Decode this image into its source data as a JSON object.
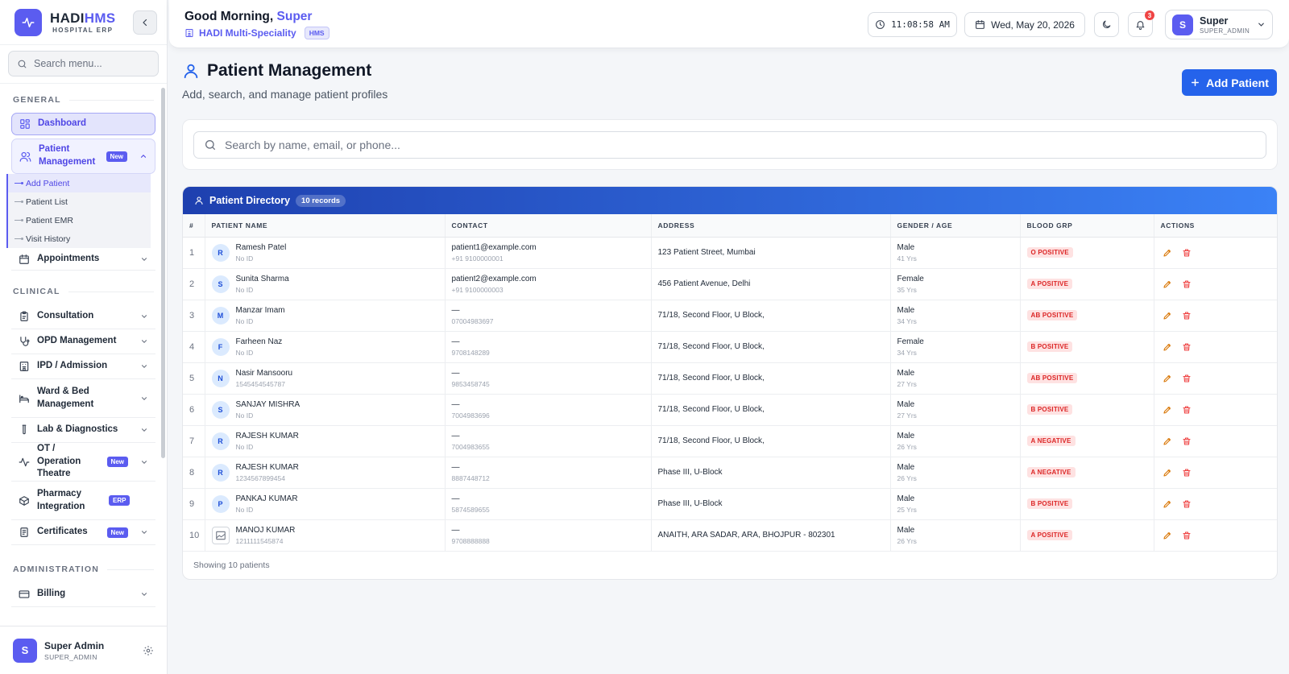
{
  "brand": {
    "name_part1": "HADI",
    "name_part2": "HMS",
    "subtitle": "HOSPITAL ERP"
  },
  "sidebar": {
    "search_placeholder": "Search menu...",
    "sections": {
      "general": "GENERAL",
      "clinical": "CLINICAL",
      "administration": "ADMINISTRATION"
    },
    "items": {
      "dashboard": "Dashboard",
      "patient_management": "Patient Management",
      "appointments": "Appointments",
      "consultation": "Consultation",
      "opd": "OPD Management",
      "ipd": "IPD / Admission",
      "ward": "Ward & Bed Management",
      "lab": "Lab & Diagnostics",
      "ot": "OT / Operation Theatre",
      "pharmacy": "Pharmacy Integration",
      "certificates": "Certificates",
      "billing": "Billing"
    },
    "submenu": [
      "Add Patient",
      "Patient List",
      "Patient EMR",
      "Visit History"
    ],
    "badges": {
      "new": "New",
      "erp": "ERP"
    },
    "footer": {
      "avatar": "S",
      "name": "Super Admin",
      "role": "SUPER_ADMIN"
    }
  },
  "header": {
    "greeting": "Good Morning,",
    "user_first": "Super",
    "hospital": "HADI Multi-Speciality",
    "hospital_tag": "HMS",
    "time": "11:08:58 AM",
    "date": "Wed, May 20, 2026",
    "notification_count": "3",
    "user": {
      "avatar": "S",
      "name": "Super",
      "role": "SUPER_ADMIN"
    }
  },
  "page": {
    "title": "Patient Management",
    "subtitle": "Add, search, and manage patient profiles",
    "add_button": "Add Patient",
    "search_placeholder": "Search by name, email, or phone..."
  },
  "directory": {
    "title": "Patient Directory",
    "records": "10 records",
    "columns": [
      "#",
      "PATIENT NAME",
      "CONTACT",
      "ADDRESS",
      "GENDER / AGE",
      "BLOOD GRP",
      "ACTIONS"
    ],
    "rows": [
      {
        "n": "1",
        "initial": "R",
        "name": "Ramesh Patel",
        "pid": "No ID",
        "email": "patient1@example.com",
        "phone": "+91 9100000001",
        "address": "123 Patient Street, Mumbai",
        "gender": "Male",
        "age": "41 Yrs",
        "blood": "O POSITIVE"
      },
      {
        "n": "2",
        "initial": "S",
        "name": "Sunita Sharma",
        "pid": "No ID",
        "email": "patient2@example.com",
        "phone": "+91 9100000003",
        "address": "456 Patient Avenue, Delhi",
        "gender": "Female",
        "age": "35 Yrs",
        "blood": "A POSITIVE"
      },
      {
        "n": "3",
        "initial": "M",
        "name": "Manzar Imam",
        "pid": "No ID",
        "email": "—",
        "phone": "07004983697",
        "address": "71/18, Second Floor, U Block,",
        "gender": "Male",
        "age": "34 Yrs",
        "blood": "AB POSITIVE"
      },
      {
        "n": "4",
        "initial": "F",
        "name": "Farheen Naz",
        "pid": "No ID",
        "email": "—",
        "phone": "9708148289",
        "address": "71/18, Second Floor, U Block,",
        "gender": "Female",
        "age": "34 Yrs",
        "blood": "B POSITIVE"
      },
      {
        "n": "5",
        "initial": "N",
        "name": "Nasir Mansooru",
        "pid": "1545454545787",
        "email": "—",
        "phone": "9853458745",
        "address": "71/18, Second Floor, U Block,",
        "gender": "Male",
        "age": "27 Yrs",
        "blood": "AB POSITIVE"
      },
      {
        "n": "6",
        "initial": "S",
        "name": "SANJAY MISHRA",
        "pid": "No ID",
        "email": "—",
        "phone": "7004983696",
        "address": "71/18, Second Floor, U Block,",
        "gender": "Male",
        "age": "27 Yrs",
        "blood": "B POSITIVE"
      },
      {
        "n": "7",
        "initial": "R",
        "name": "RAJESH KUMAR",
        "pid": "No ID",
        "email": "—",
        "phone": "7004983655",
        "address": "71/18, Second Floor, U Block,",
        "gender": "Male",
        "age": "26 Yrs",
        "blood": "A NEGATIVE"
      },
      {
        "n": "8",
        "initial": "R",
        "name": "RAJESH KUMAR",
        "pid": "1234567899454",
        "email": "—",
        "phone": "8887448712",
        "address": "Phase III, U-Block",
        "gender": "Male",
        "age": "26 Yrs",
        "blood": "A NEGATIVE"
      },
      {
        "n": "9",
        "initial": "P",
        "name": "PANKAJ KUMAR",
        "pid": "No ID",
        "email": "—",
        "phone": "5874589655",
        "address": "Phase III, U-Block",
        "gender": "Male",
        "age": "25 Yrs",
        "blood": "B POSITIVE"
      },
      {
        "n": "10",
        "initial": "",
        "name": "MANOJ KUMAR",
        "pid": "1211111545874",
        "email": "—",
        "phone": "9708888888",
        "address": "ANAITH, ARA SADAR, ARA, BHOJPUR - 802301",
        "gender": "Male",
        "age": "26 Yrs",
        "blood": "A POSITIVE"
      }
    ],
    "footer": "Showing 10 patients"
  },
  "colors": {
    "primary": "#5b5cf0",
    "action_blue": "#2563eb",
    "danger": "#ef4444",
    "edit": "#d97706"
  }
}
